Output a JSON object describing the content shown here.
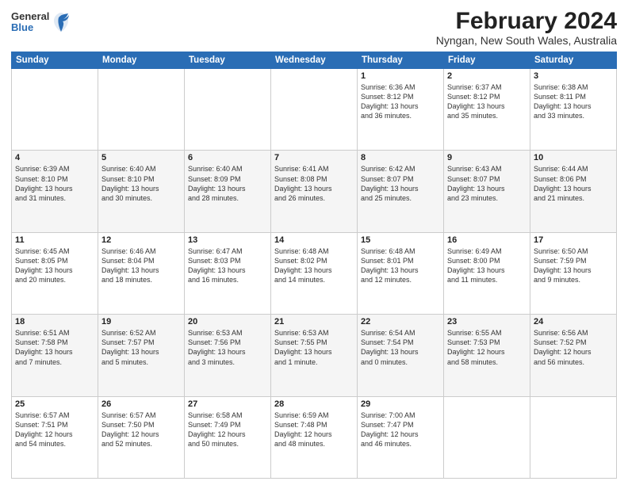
{
  "header": {
    "logo": {
      "general": "General",
      "blue": "Blue"
    },
    "title": "February 2024",
    "subtitle": "Nyngan, New South Wales, Australia"
  },
  "days_of_week": [
    "Sunday",
    "Monday",
    "Tuesday",
    "Wednesday",
    "Thursday",
    "Friday",
    "Saturday"
  ],
  "weeks": [
    [
      {
        "day": "",
        "info": ""
      },
      {
        "day": "",
        "info": ""
      },
      {
        "day": "",
        "info": ""
      },
      {
        "day": "",
        "info": ""
      },
      {
        "day": "1",
        "info": "Sunrise: 6:36 AM\nSunset: 8:12 PM\nDaylight: 13 hours\nand 36 minutes."
      },
      {
        "day": "2",
        "info": "Sunrise: 6:37 AM\nSunset: 8:12 PM\nDaylight: 13 hours\nand 35 minutes."
      },
      {
        "day": "3",
        "info": "Sunrise: 6:38 AM\nSunset: 8:11 PM\nDaylight: 13 hours\nand 33 minutes."
      }
    ],
    [
      {
        "day": "4",
        "info": "Sunrise: 6:39 AM\nSunset: 8:10 PM\nDaylight: 13 hours\nand 31 minutes."
      },
      {
        "day": "5",
        "info": "Sunrise: 6:40 AM\nSunset: 8:10 PM\nDaylight: 13 hours\nand 30 minutes."
      },
      {
        "day": "6",
        "info": "Sunrise: 6:40 AM\nSunset: 8:09 PM\nDaylight: 13 hours\nand 28 minutes."
      },
      {
        "day": "7",
        "info": "Sunrise: 6:41 AM\nSunset: 8:08 PM\nDaylight: 13 hours\nand 26 minutes."
      },
      {
        "day": "8",
        "info": "Sunrise: 6:42 AM\nSunset: 8:07 PM\nDaylight: 13 hours\nand 25 minutes."
      },
      {
        "day": "9",
        "info": "Sunrise: 6:43 AM\nSunset: 8:07 PM\nDaylight: 13 hours\nand 23 minutes."
      },
      {
        "day": "10",
        "info": "Sunrise: 6:44 AM\nSunset: 8:06 PM\nDaylight: 13 hours\nand 21 minutes."
      }
    ],
    [
      {
        "day": "11",
        "info": "Sunrise: 6:45 AM\nSunset: 8:05 PM\nDaylight: 13 hours\nand 20 minutes."
      },
      {
        "day": "12",
        "info": "Sunrise: 6:46 AM\nSunset: 8:04 PM\nDaylight: 13 hours\nand 18 minutes."
      },
      {
        "day": "13",
        "info": "Sunrise: 6:47 AM\nSunset: 8:03 PM\nDaylight: 13 hours\nand 16 minutes."
      },
      {
        "day": "14",
        "info": "Sunrise: 6:48 AM\nSunset: 8:02 PM\nDaylight: 13 hours\nand 14 minutes."
      },
      {
        "day": "15",
        "info": "Sunrise: 6:48 AM\nSunset: 8:01 PM\nDaylight: 13 hours\nand 12 minutes."
      },
      {
        "day": "16",
        "info": "Sunrise: 6:49 AM\nSunset: 8:00 PM\nDaylight: 13 hours\nand 11 minutes."
      },
      {
        "day": "17",
        "info": "Sunrise: 6:50 AM\nSunset: 7:59 PM\nDaylight: 13 hours\nand 9 minutes."
      }
    ],
    [
      {
        "day": "18",
        "info": "Sunrise: 6:51 AM\nSunset: 7:58 PM\nDaylight: 13 hours\nand 7 minutes."
      },
      {
        "day": "19",
        "info": "Sunrise: 6:52 AM\nSunset: 7:57 PM\nDaylight: 13 hours\nand 5 minutes."
      },
      {
        "day": "20",
        "info": "Sunrise: 6:53 AM\nSunset: 7:56 PM\nDaylight: 13 hours\nand 3 minutes."
      },
      {
        "day": "21",
        "info": "Sunrise: 6:53 AM\nSunset: 7:55 PM\nDaylight: 13 hours\nand 1 minute."
      },
      {
        "day": "22",
        "info": "Sunrise: 6:54 AM\nSunset: 7:54 PM\nDaylight: 13 hours\nand 0 minutes."
      },
      {
        "day": "23",
        "info": "Sunrise: 6:55 AM\nSunset: 7:53 PM\nDaylight: 12 hours\nand 58 minutes."
      },
      {
        "day": "24",
        "info": "Sunrise: 6:56 AM\nSunset: 7:52 PM\nDaylight: 12 hours\nand 56 minutes."
      }
    ],
    [
      {
        "day": "25",
        "info": "Sunrise: 6:57 AM\nSunset: 7:51 PM\nDaylight: 12 hours\nand 54 minutes."
      },
      {
        "day": "26",
        "info": "Sunrise: 6:57 AM\nSunset: 7:50 PM\nDaylight: 12 hours\nand 52 minutes."
      },
      {
        "day": "27",
        "info": "Sunrise: 6:58 AM\nSunset: 7:49 PM\nDaylight: 12 hours\nand 50 minutes."
      },
      {
        "day": "28",
        "info": "Sunrise: 6:59 AM\nSunset: 7:48 PM\nDaylight: 12 hours\nand 48 minutes."
      },
      {
        "day": "29",
        "info": "Sunrise: 7:00 AM\nSunset: 7:47 PM\nDaylight: 12 hours\nand 46 minutes."
      },
      {
        "day": "",
        "info": ""
      },
      {
        "day": "",
        "info": ""
      }
    ]
  ]
}
